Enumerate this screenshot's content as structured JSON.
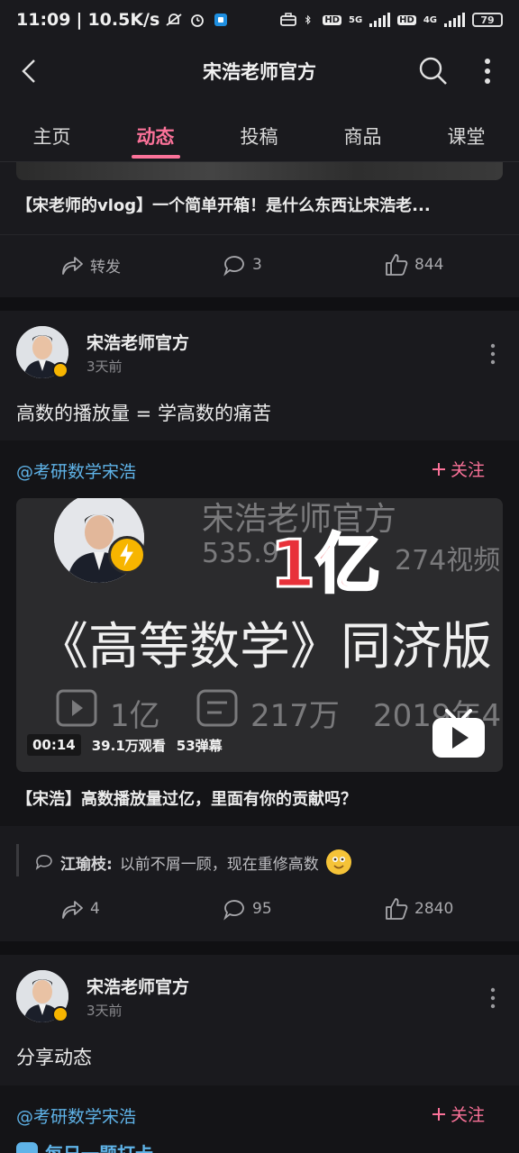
{
  "status_bar": {
    "time": "11:09",
    "net_speed": "10.5K/s",
    "battery": "79",
    "net_5g": "5G",
    "net_4g": "4G",
    "hd1": "HD",
    "hd2": "HD"
  },
  "nav": {
    "title": "宋浩老师官方"
  },
  "tabs": [
    {
      "label": "主页"
    },
    {
      "label": "动态"
    },
    {
      "label": "投稿"
    },
    {
      "label": "商品"
    },
    {
      "label": "课堂"
    }
  ],
  "active_tab": "动态",
  "accent_color": "#fb7299",
  "post0": {
    "title": "【宋老师的vlog】一个简单开箱！是什么东西让宋浩老...",
    "actions": {
      "share": "转发",
      "comments": "3",
      "likes": "844"
    }
  },
  "post1": {
    "author": "宋浩老师官方",
    "time": "3天前",
    "text": "高数的播放量 =  学高数的痛苦",
    "repost": {
      "user": "@考研数学宋浩",
      "follow": "关注",
      "video": {
        "line_top": "宋浩老师官方",
        "stat_left": "535.9",
        "stat_right": "274视频",
        "big_overlay": "1亿",
        "main_text": "《高等数学》同济版",
        "plays_text": "1亿",
        "danmaku_text": "217万",
        "date_text": "2019年4",
        "duration": "00:14",
        "views": "39.1万观看",
        "danmaku": "53弹幕"
      },
      "title": "【宋浩】高数播放量过亿，里面有你的贡献吗？"
    },
    "comment": {
      "name": "江瑜枝:",
      "text": "以前不屑一顾，现在重修高数"
    },
    "actions": {
      "share": "4",
      "comments": "95",
      "likes": "2840"
    }
  },
  "post2": {
    "author": "宋浩老师官方",
    "time": "3天前",
    "text": "分享动态",
    "repost": {
      "user": "@考研数学宋浩",
      "follow": "关注",
      "partial_title": "每日一题打卡"
    }
  }
}
